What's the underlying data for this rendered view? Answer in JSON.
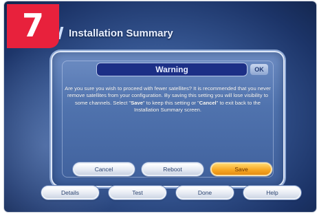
{
  "step_number": "7",
  "title": "Installation Summary",
  "dialog": {
    "header": "Warning",
    "close_label": "OK",
    "message_parts": [
      "Are you sure you wish to proceed with fewer satellites? It is recommended that you never remove satellites from your configuration. By saving this setting you will lose visibility to some channels. Select \"",
      "Save",
      "\" to keep this setting or \"",
      "Cancel",
      "\" to exit back to the Installation Summary screen."
    ],
    "buttons": {
      "cancel": "Cancel",
      "reboot": "Reboot",
      "save": "Save"
    }
  },
  "nav": {
    "details": "Details",
    "test": "Test",
    "done": "Done",
    "help": "Help"
  },
  "colors": {
    "badge": "#e8213c",
    "primary_button": "#f7a825",
    "warning_header": "#1c2f86"
  }
}
